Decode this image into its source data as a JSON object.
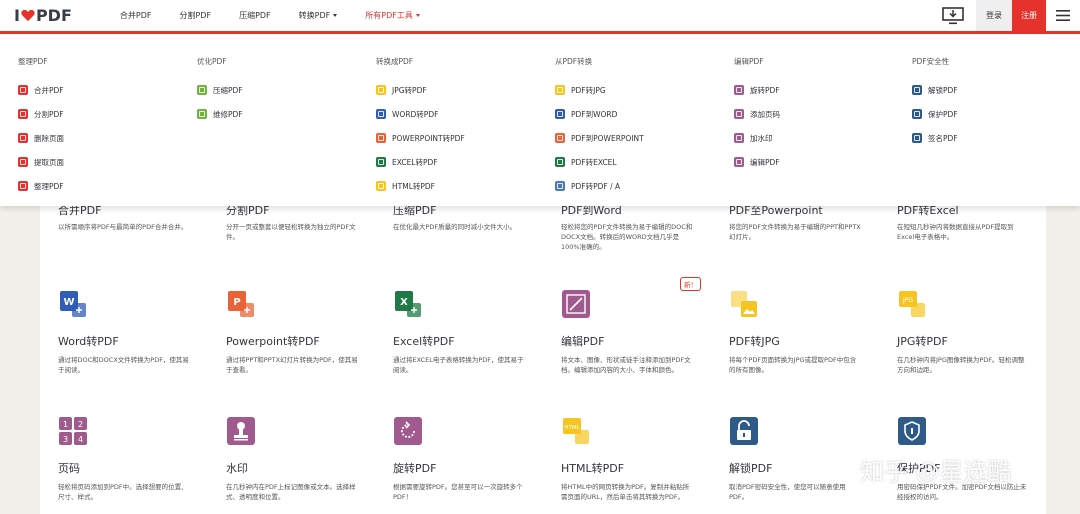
{
  "header": {
    "logo_left": "I",
    "logo_right": "PDF",
    "nav": [
      {
        "label": "合并PDF"
      },
      {
        "label": "分割PDF"
      },
      {
        "label": "压缩PDF"
      },
      {
        "label": "转换PDF"
      },
      {
        "label": "所有PDF工具"
      }
    ],
    "login": "登录",
    "signup": "注册"
  },
  "menu": {
    "columns": [
      {
        "title": "整理PDF",
        "items": [
          {
            "label": "合并PDF",
            "color": "#e5322d"
          },
          {
            "label": "分割PDF",
            "color": "#e5322d"
          },
          {
            "label": "删除页面",
            "color": "#e5322d"
          },
          {
            "label": "提取页面",
            "color": "#e5322d"
          },
          {
            "label": "整理PDF",
            "color": "#e5322d"
          }
        ]
      },
      {
        "title": "优化PDF",
        "items": [
          {
            "label": "压缩PDF",
            "color": "#6fb33c"
          },
          {
            "label": "维修PDF",
            "color": "#6fb33c"
          }
        ]
      },
      {
        "title": "转换成PDF",
        "items": [
          {
            "label": "JPG转PDF",
            "color": "#f7c520"
          },
          {
            "label": "WORD转PDF",
            "color": "#2f5db8"
          },
          {
            "label": "POWERPOINT转PDF",
            "color": "#e86438"
          },
          {
            "label": "EXCEL转PDF",
            "color": "#1f7a45"
          },
          {
            "label": "HTML转PDF",
            "color": "#f7c520"
          }
        ]
      },
      {
        "title": "从PDF转换",
        "items": [
          {
            "label": "PDF转JPG",
            "color": "#f7c520"
          },
          {
            "label": "PDF到WORD",
            "color": "#2f5db8"
          },
          {
            "label": "PDF到POWERPOINT",
            "color": "#e86438"
          },
          {
            "label": "PDF转EXCEL",
            "color": "#1f7a45"
          },
          {
            "label": "PDF转PDF / A",
            "color": "#4a7ab8"
          }
        ]
      },
      {
        "title": "编辑PDF",
        "items": [
          {
            "label": "旋转PDF",
            "color": "#a05a8e"
          },
          {
            "label": "添加页码",
            "color": "#a05a8e"
          },
          {
            "label": "加水印",
            "color": "#a05a8e"
          },
          {
            "label": "编辑PDF",
            "color": "#a05a8e"
          }
        ]
      },
      {
        "title": "PDF安全性",
        "items": [
          {
            "label": "解锁PDF",
            "color": "#2e5a8a"
          },
          {
            "label": "保护PDF",
            "color": "#2e5a8a"
          },
          {
            "label": "签名PDF",
            "color": "#2e5a8a"
          }
        ]
      }
    ]
  },
  "tools_row0": [
    {
      "title": "合并PDF",
      "desc": "以所需顺序将PDF与最简单的PDF合并合并。"
    },
    {
      "title": "分割PDF",
      "desc": "分开一页或整套以便轻松转换为独立的PDF文件。"
    },
    {
      "title": "压缩PDF",
      "desc": "在优化最大PDF质量的同时减小文件大小。"
    },
    {
      "title": "PDF到Word",
      "desc": "轻松将您的PDF文件转换为易于编辑的DOC和DOCX文档。转换后的WORD文档几乎是100%准确的。"
    },
    {
      "title": "PDF至Powerpoint",
      "desc": "将您的PDF文件转换为易于编辑的PPT和PPTX幻灯片。"
    },
    {
      "title": "PDF转Excel",
      "desc": "在短短几秒钟内将数据直接从PDF提取到Excel电子表格中。"
    }
  ],
  "tools_row1": [
    {
      "title": "Word转PDF",
      "desc": "通过将DOC和DOCX文件转换为PDF，使其易于阅读。",
      "color": "#2f5db8"
    },
    {
      "title": "Powerpoint转PDF",
      "desc": "通过将PPT和PPTX幻灯片转换为PDF，使其易于查看。",
      "color": "#e86438"
    },
    {
      "title": "Excel转PDF",
      "desc": "通过将EXCEL电子表格转换为PDF，使其易于阅读。",
      "color": "#1f7a45"
    },
    {
      "title": "编辑PDF",
      "desc": "将文本、图像、形状或徒手注释添加到PDF文档。编辑添加内容的大小、字体和颜色。",
      "color": "#a05a8e"
    },
    {
      "title": "PDF转JPG",
      "desc": "将每个PDF页面转换为JPG或提取PDF中包含的所有图像。",
      "color": "#f7c520"
    },
    {
      "title": "JPG转PDF",
      "desc": "在几秒钟内将JPG图像转换为PDF。轻松调整方向和边距。",
      "color": "#f7c520"
    }
  ],
  "tools_row2": [
    {
      "title": "页码",
      "desc": "轻松将页码添加到PDF中。选择想要的位置、尺寸、样式。",
      "color": "#a05a8e"
    },
    {
      "title": "水印",
      "desc": "在几秒钟内在PDF上标记图像或文本。选择样式、透明度和位置。",
      "color": "#a05a8e"
    },
    {
      "title": "旋转PDF",
      "desc": "根据需要旋转PDF。您甚至可以一次旋转多个PDF！",
      "color": "#a05a8e"
    },
    {
      "title": "HTML转PDF",
      "desc": "将HTML中的网页转换为PDF。复制并粘贴所需页面的URL，然后单击将其转换为PDF。",
      "color": "#f7c520"
    },
    {
      "title": "解锁PDF",
      "desc": "取消PDF密码安全性，使您可以随意使用PDF。",
      "color": "#2e5a8a"
    },
    {
      "title": "保护PDF",
      "desc": "用密码保护PDF文件。加密PDF文档以防止未经授权的访问。",
      "color": "#2e5a8a"
    }
  ],
  "new_badge": "新！",
  "watermark": "知乎 @星选酷"
}
